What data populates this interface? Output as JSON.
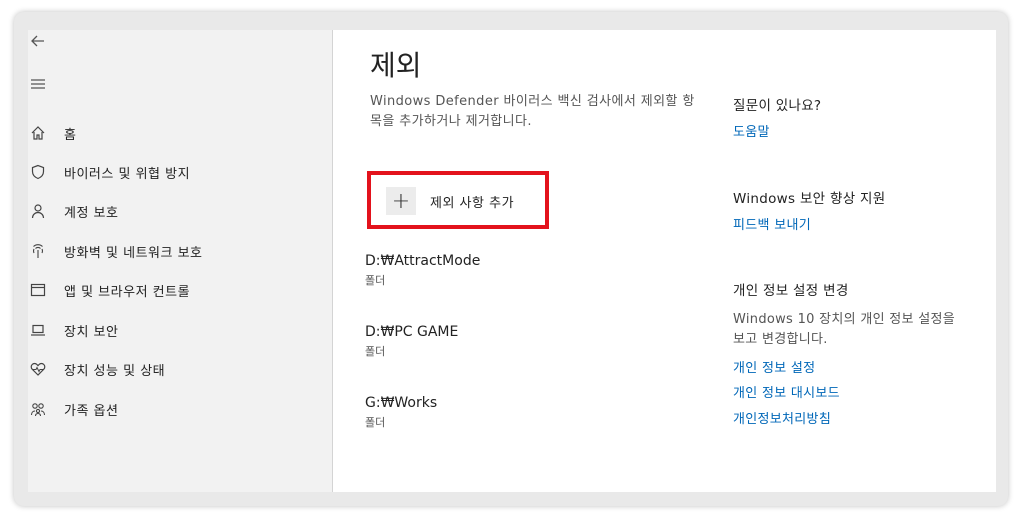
{
  "sidebar": {
    "items": [
      {
        "label": "홈",
        "icon": "home-icon"
      },
      {
        "label": "바이러스 및 위협 방지",
        "icon": "shield-icon"
      },
      {
        "label": "계정 보호",
        "icon": "person-icon"
      },
      {
        "label": "방화벽 및 네트워크 보호",
        "icon": "wifi-icon"
      },
      {
        "label": "앱 및 브라우저 컨트롤",
        "icon": "browser-icon"
      },
      {
        "label": "장치 보안",
        "icon": "laptop-icon"
      },
      {
        "label": "장치 성능 및 상태",
        "icon": "heart-icon"
      },
      {
        "label": "가족 옵션",
        "icon": "family-icon"
      }
    ]
  },
  "main": {
    "title": "제외",
    "description": "Windows Defender 바이러스 백신 검사에서 제외할 항목을 추가하거나 제거합니다.",
    "add_button_label": "제외 사항 추가",
    "exclusions": [
      {
        "path": "D:₩AttractMode",
        "type": "폴더"
      },
      {
        "path": "D:₩PC GAME",
        "type": "폴더"
      },
      {
        "path": "G:₩Works",
        "type": "폴더"
      }
    ]
  },
  "right": {
    "question_heading": "질문이 있나요?",
    "help_link": "도움말",
    "improve_heading": "Windows 보안 향상 지원",
    "feedback_link": "피드백 보내기",
    "privacy_heading": "개인 정보 설정 변경",
    "privacy_text": "Windows 10 장치의 개인 정보 설정을 보고 변경합니다.",
    "privacy_links": [
      "개인 정보 설정",
      "개인 정보 대시보드",
      "개인정보처리방침"
    ]
  },
  "colors": {
    "accent": "#0067b8",
    "highlight_border": "#e3121c"
  }
}
